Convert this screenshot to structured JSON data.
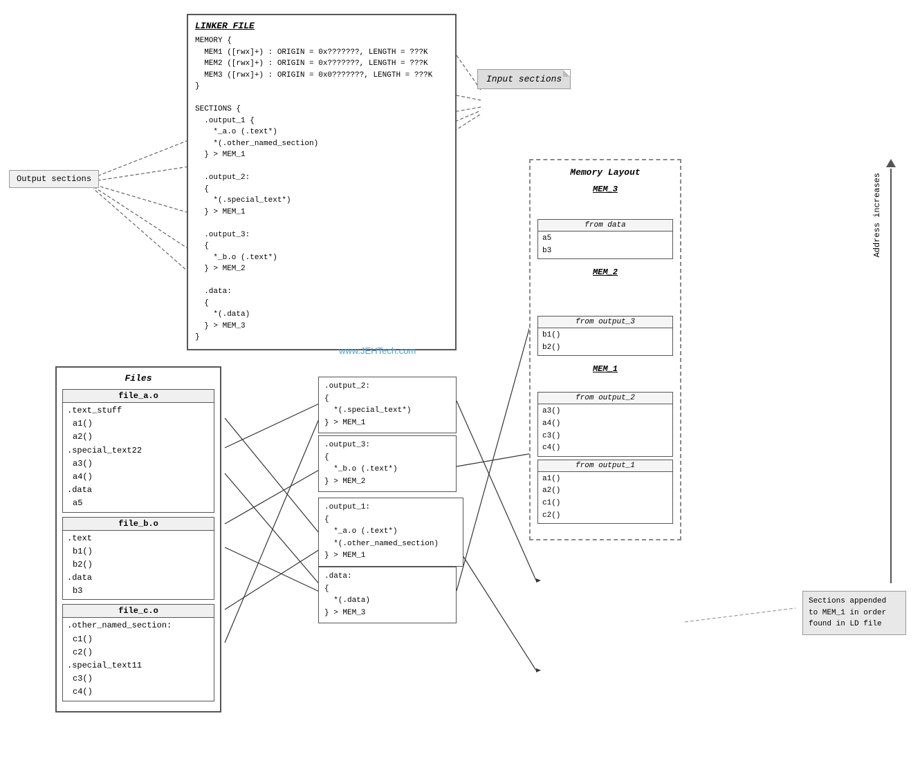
{
  "linker_file": {
    "title": "LINKER FILE",
    "content": "MEMORY {\n  MEM1 ([rwx]+) : ORIGIN = 0x???????, LENGTH = ???K\n  MEM2 ([rwx]+) : ORIGIN = 0x???????, LENGTH = ???K\n  MEM3 ([rwx]+) : ORIGIN = 0x0???????, LENGTH = ???K\n}\n\nSECTIONS {\n  .output_1 {\n    *_a.o (.text*)\n    *(.other_named_section)\n  } > MEM_1\n\n  .output_2:\n  {\n    *(.special_text*)\n  } > MEM_1\n\n  .output_3:\n  {\n    *_b.o (.text*)\n  } > MEM_2\n\n  .data:\n  {\n    *(.data)\n  } > MEM_3\n}"
  },
  "labels": {
    "input_sections": "Input sections",
    "output_sections": "Output sections",
    "files": "Files",
    "memory_layout": "Memory Layout",
    "address_increases": "Address increases",
    "watermark": "www.JEHTech.com",
    "sections_note": "Sections appended to MEM_1 in order found in LD file"
  },
  "files": {
    "file_a": {
      "name": "file_a.o",
      "sections": [
        {
          "name": ".text_stuff",
          "symbols": "a1()\na2()"
        },
        {
          "name": ".special_text22",
          "symbols": "a3()\na4()"
        },
        {
          "name": ".data",
          "symbols": "a5"
        }
      ]
    },
    "file_b": {
      "name": "file_b.o",
      "sections": [
        {
          "name": ".text",
          "symbols": "b1()\nb2()"
        },
        {
          "name": ".data",
          "symbols": "b3"
        }
      ]
    },
    "file_c": {
      "name": "file_c.o",
      "sections": [
        {
          "name": ".other_named_section:",
          "symbols": "c1()\nc2()"
        },
        {
          "name": ".special_text11",
          "symbols": "c3()\nc4()"
        }
      ]
    }
  },
  "middle_sections": {
    "output_2": ".output_2:\n{\n  *(.special_text*)\n} > MEM_1",
    "output_3": ".output_3:\n{\n  *_b.o (.text*)\n} > MEM_2",
    "output_1": ".output_1:\n{\n  *_a.o (.text*)\n  *(.other_named_section)\n} > MEM_1",
    "data": ".data:\n{\n  *(.data)\n} > MEM_3"
  },
  "memory_layout": {
    "mem3": {
      "name": "MEM_3",
      "sections": [
        {
          "label": "from data",
          "data": "a5\nb3"
        }
      ]
    },
    "mem2": {
      "name": "MEM_2",
      "sections": [
        {
          "label": "from output_3",
          "data": "b1()\nb2()"
        }
      ]
    },
    "mem1": {
      "name": "MEM_1",
      "sections": [
        {
          "label": "from output_2",
          "data": "a3()\na4()\nc3()\nc4()"
        },
        {
          "label": "from output_1",
          "data": "a1()\na2()\nc1()\nc2()"
        }
      ]
    }
  }
}
